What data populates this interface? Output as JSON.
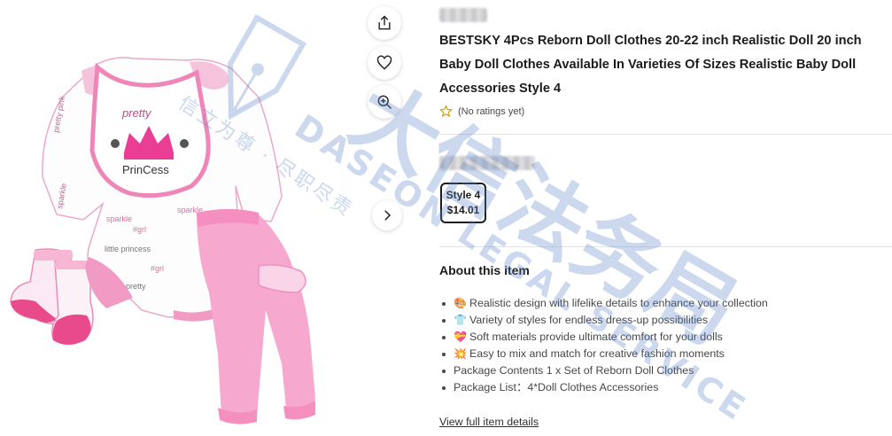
{
  "product": {
    "title": "BESTSKY 4Pcs Reborn Doll Clothes 20-22 inch Realistic Doll 20 inch Baby Doll Clothes Available In Varieties Of Sizes Realistic Baby Doll Accessories Style 4",
    "rating_text": "(No ratings yet)",
    "variant": {
      "name": "Style 4",
      "price": "$14.01",
      "selected": true
    }
  },
  "icons": {
    "share": "share-icon",
    "favorite": "heart-icon",
    "zoom": "zoom-in-icon",
    "next": "chevron-right-icon",
    "rating": "star-outline-icon"
  },
  "about": {
    "heading": "About this item",
    "items": [
      {
        "icon": "🎨",
        "text": "Realistic design with lifelike details to enhance your collection"
      },
      {
        "icon": "👕",
        "text": "Variety of styles for endless dress-up possibilities"
      },
      {
        "icon": "💝",
        "text": "Soft materials provide ultimate comfort for your dolls"
      },
      {
        "icon": "💥",
        "text": "Easy to mix and match for creative fashion moments"
      },
      {
        "icon": "",
        "text": "Package Contents 1 x Set of Reborn Doll Clothes"
      },
      {
        "icon": "",
        "text": "Package List：4*Doll Clothes Accessories"
      }
    ],
    "link": "View full item details"
  },
  "watermark": {
    "brand": "DASEON LEGAL SERVICE",
    "motto": "大信法务局",
    "slogan": "信立为尊 · 尽职尽责"
  },
  "colors": {
    "pink_bright": "#f05aa0",
    "pink_soft": "#f7a8cf",
    "watermark_blue": "#5b86c6",
    "text_dark": "#1b1c1e",
    "star_gold": "#c99a05"
  }
}
